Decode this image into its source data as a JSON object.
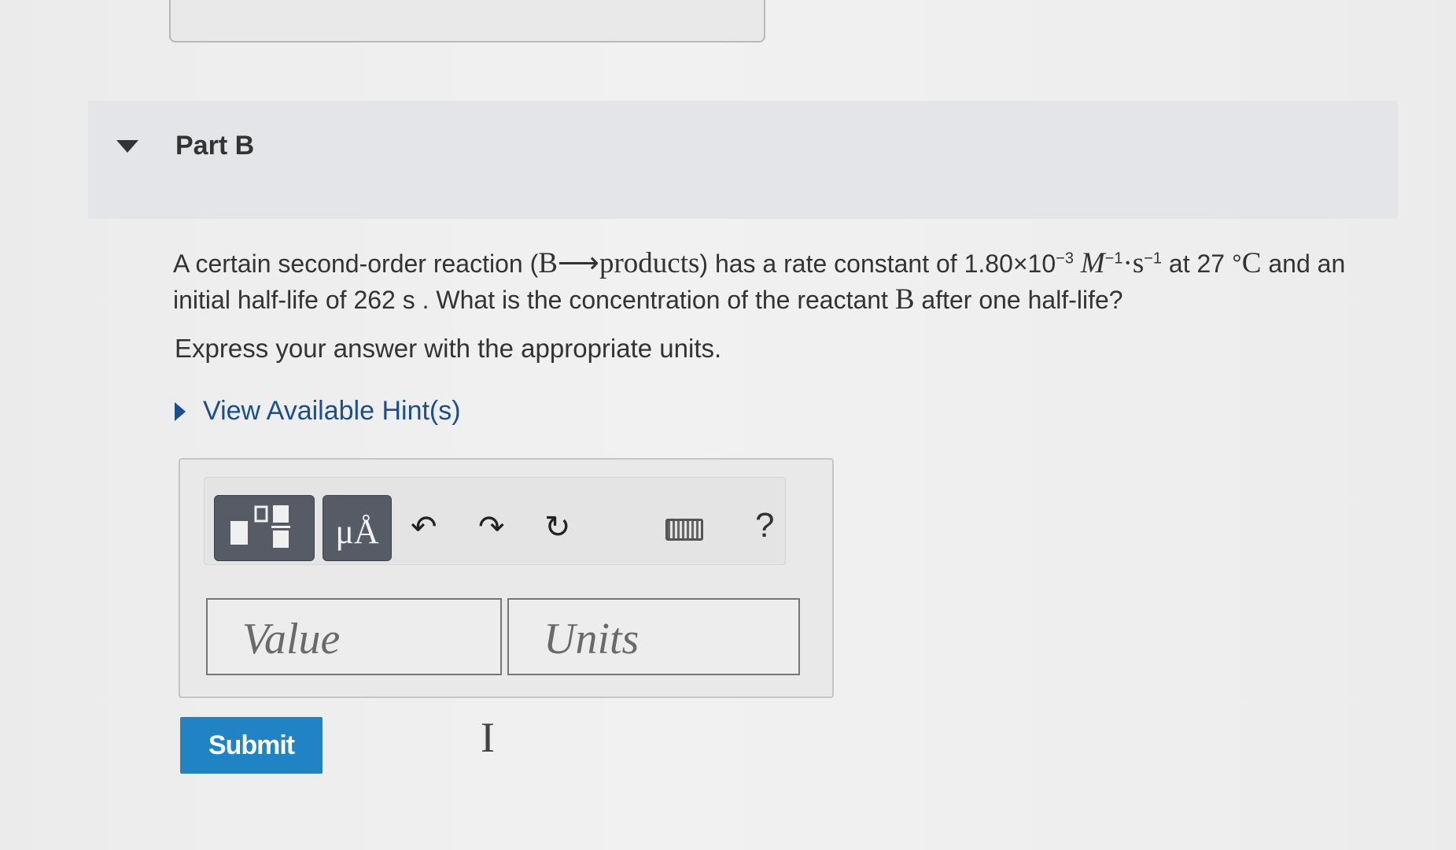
{
  "part": {
    "title": "Part B"
  },
  "question": {
    "t1": "A certain second-order reaction (",
    "reaction": "B⟶products",
    "t2": ") has a rate constant of 1.80×10",
    "exp_minus3": "−3",
    "unit_M": "M",
    "exp_m1a": "−1",
    "dot": "·",
    "unit_s": "s",
    "exp_m1b": "−1",
    "t3": " at 27 °",
    "unit_C": "C",
    "t4": " and an initial half-life of 262 s . What is the concentration of the reactant ",
    "reactant": "B",
    "t5": " after one half-life?"
  },
  "instruction": "Express your answer with the appropriate units.",
  "hint": {
    "label": "View Available Hint(s)"
  },
  "toolbar": {
    "units_label": "μÅ",
    "undo_glyph": "↶",
    "redo_glyph": "↷",
    "reset_glyph": "↻",
    "help_label": "?"
  },
  "inputs": {
    "value_placeholder": "Value",
    "units_placeholder": "Units"
  },
  "submit_label": "Submit"
}
